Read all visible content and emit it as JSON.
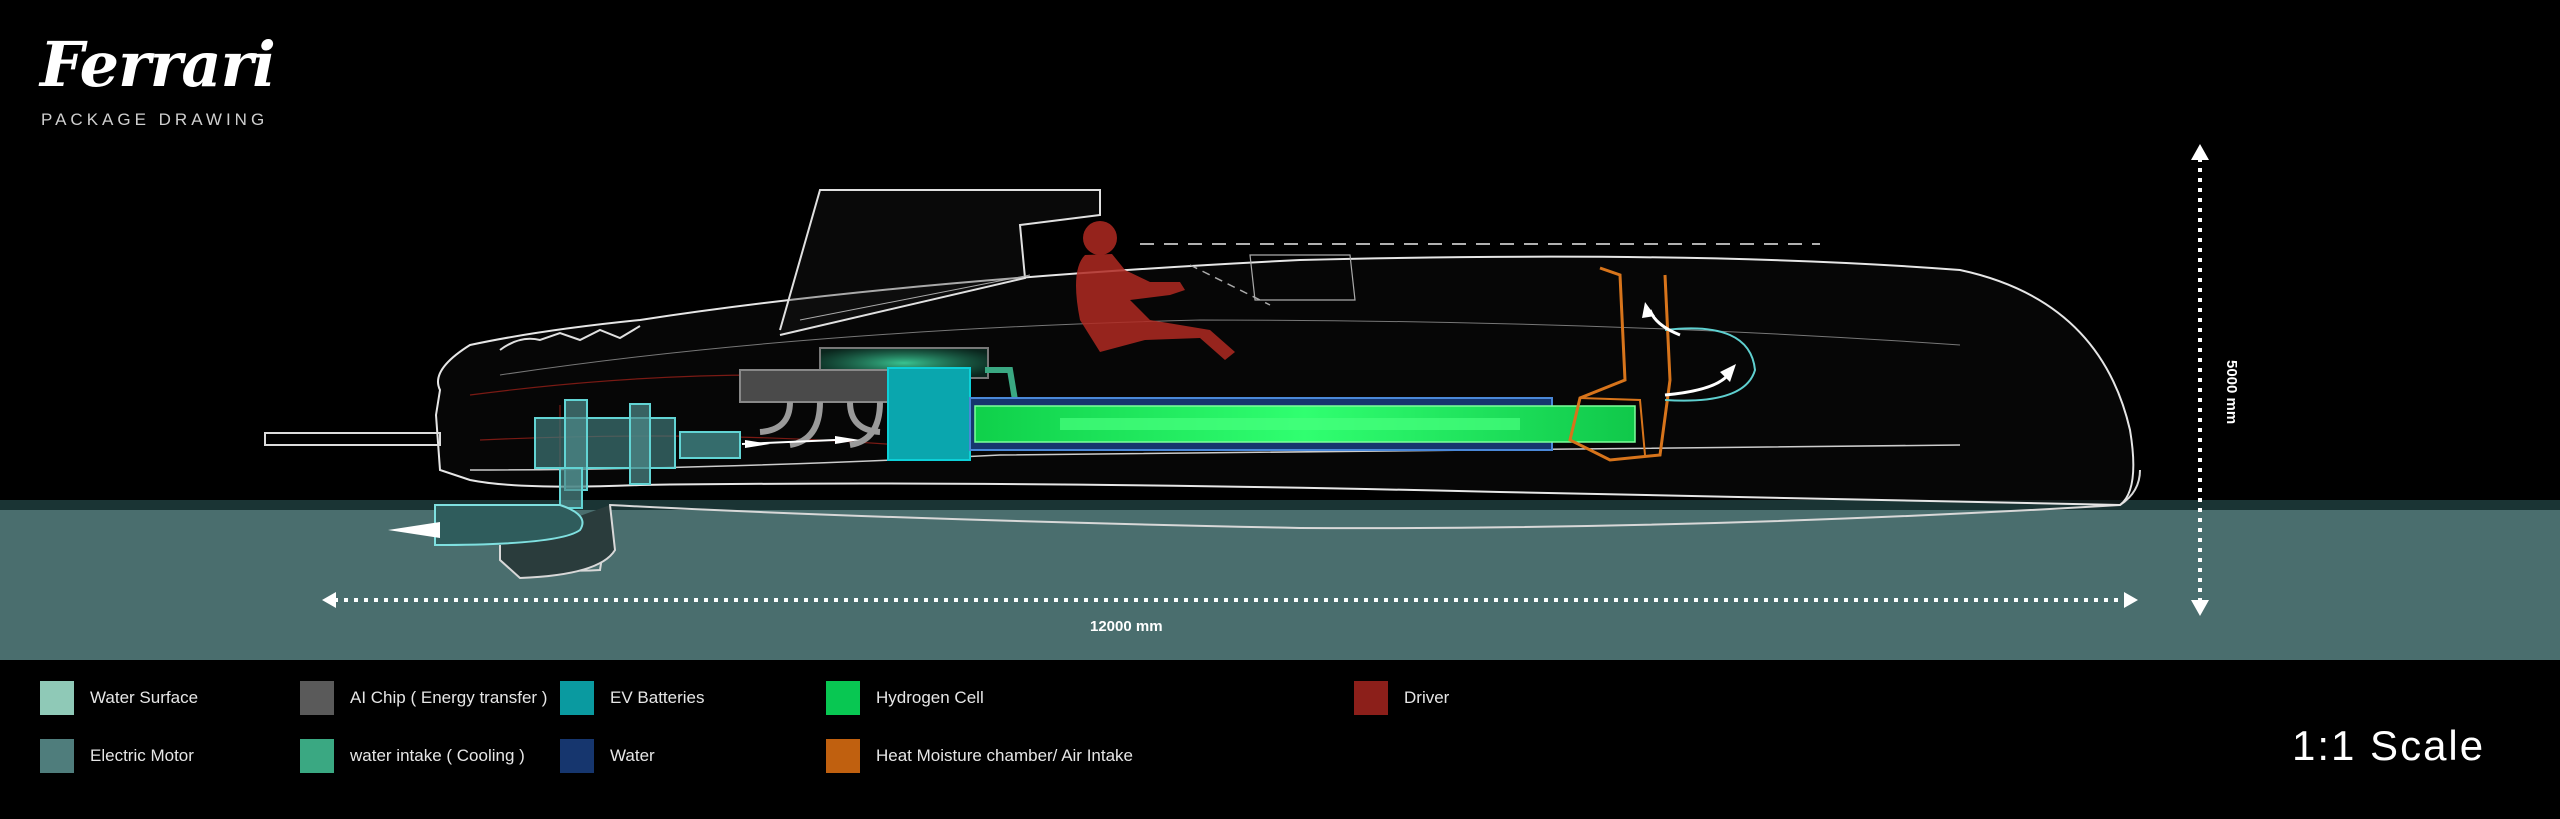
{
  "header": {
    "logo_text": "Ferrari",
    "subtitle": "PACKAGE DRAWING"
  },
  "dimensions": {
    "length_label": "12000 mm",
    "height_label": "5000 mm"
  },
  "legend": [
    {
      "id": "water-surface",
      "label": "Water Surface",
      "color": "#8fc9b7"
    },
    {
      "id": "electric-motor",
      "label": "Electric Motor",
      "color": "#4f7d7c"
    },
    {
      "id": "ai-chip",
      "label": "AI Chip ( Energy transfer )",
      "color": "#5a5a5a"
    },
    {
      "id": "water-intake",
      "label": "water intake ( Cooling )",
      "color": "#3aa882"
    },
    {
      "id": "ev-batteries",
      "label": "EV Batteries",
      "color": "#0a9aa0"
    },
    {
      "id": "water",
      "label": "Water",
      "color": "#16366e"
    },
    {
      "id": "hydrogen-cell",
      "label": "Hydrogen Cell",
      "color": "#08c752"
    },
    {
      "id": "heat-moisture",
      "label": "Heat Moisture chamber/ Air Intake",
      "color": "#c0600f"
    },
    {
      "id": "driver",
      "label": "Driver",
      "color": "#8c1f1a"
    }
  ],
  "scale_label": "1:1 Scale",
  "colors": {
    "sea": "#4a6e6e",
    "hull_line": "#e6e6e6",
    "hydrogen": "#18e04a",
    "battery": "#0aa6ae",
    "driver": "#b02a22",
    "orange": "#d7741b"
  }
}
